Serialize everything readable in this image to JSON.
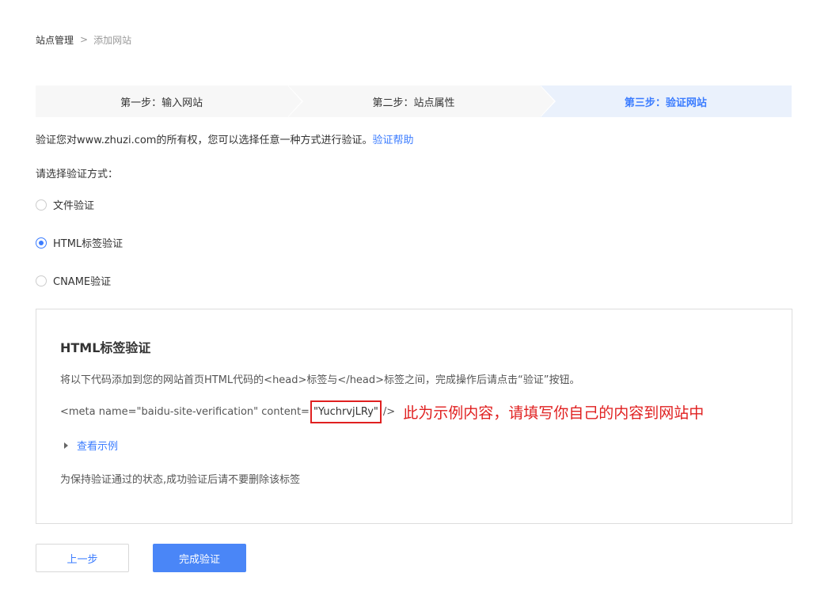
{
  "breadcrumb": {
    "root": "站点管理",
    "separator": ">",
    "current": "添加网站"
  },
  "steps": [
    {
      "label": "第一步：输入网站",
      "active": false
    },
    {
      "label": "第二步：站点属性",
      "active": false
    },
    {
      "label": "第三步：验证网站",
      "active": true
    }
  ],
  "intro": {
    "text": "验证您对www.zhuzi.com的所有权，您可以选择任意一种方式进行验证。",
    "help_link": "验证帮助"
  },
  "choose_label": "请选择验证方式：",
  "methods": [
    {
      "label": "文件验证",
      "checked": false
    },
    {
      "label": "HTML标签验证",
      "checked": true
    },
    {
      "label": "CNAME验证",
      "checked": false
    }
  ],
  "panel": {
    "title": "HTML标签验证",
    "description": "将以下代码添加到您的网站首页HTML代码的<head>标签与</head>标签之间，完成操作后请点击“验证”按钮。",
    "code_prefix": "<meta name=\"baidu-site-verification\" content=",
    "code_value": "\"YuchrvjLRy\"",
    "code_suffix": "/>",
    "annotation": "此为示例内容，请填写你自己的内容到网站中",
    "example_toggle": "查看示例",
    "note": "为保持验证通过的状态,成功验证后请不要删除该标签"
  },
  "buttons": {
    "prev": "上一步",
    "done": "完成验证"
  },
  "colors": {
    "accent": "#3b7cff",
    "highlight": "#e02020",
    "active_step_bg": "#eaf1fc"
  }
}
